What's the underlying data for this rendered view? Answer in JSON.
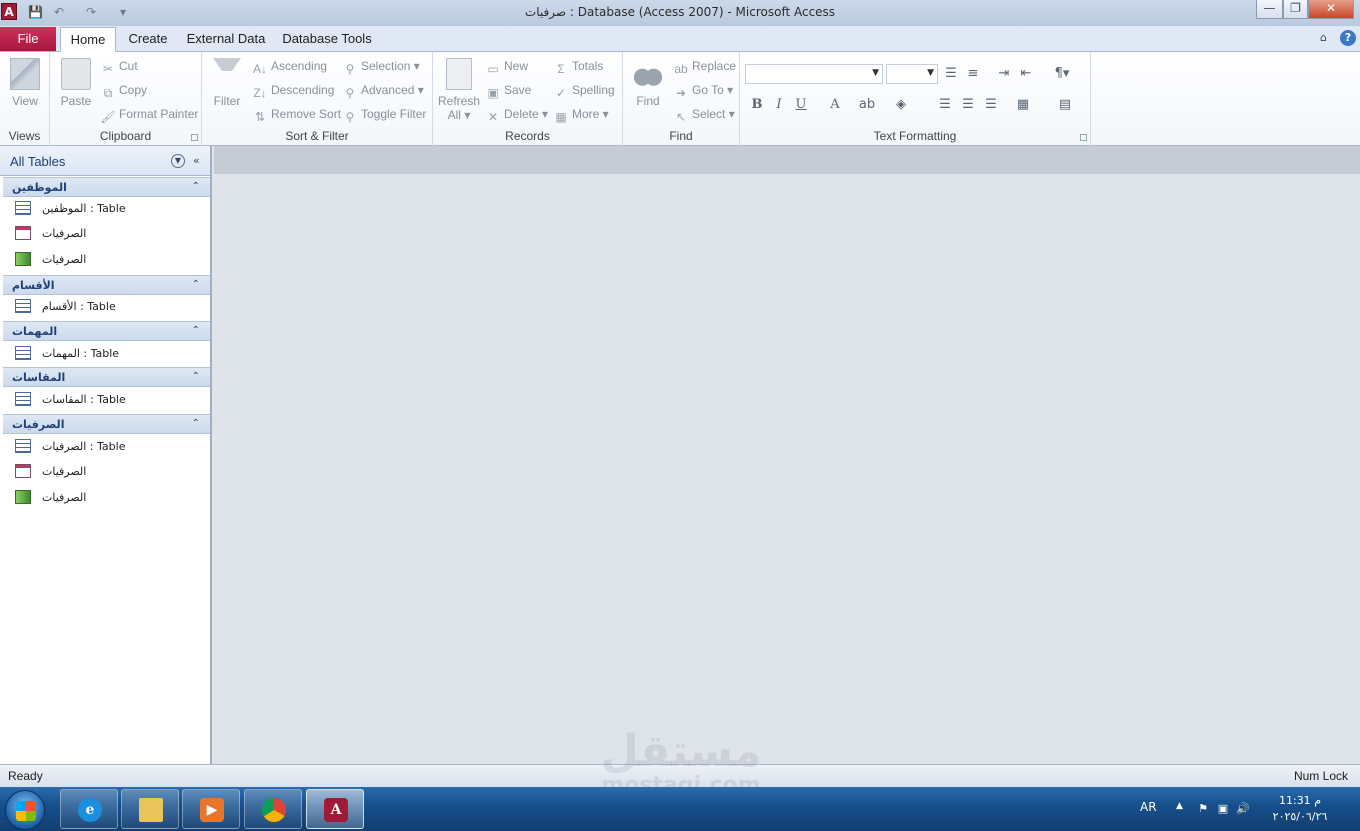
{
  "window": {
    "title": "صرفيات : Database (Access 2007)  -  Microsoft Access",
    "app_icon_glyph": "A",
    "buttons": {
      "minimize": "—",
      "restore": "❐",
      "close": "✕"
    }
  },
  "quick_access": {
    "save_icon": "save-icon",
    "undo_icon": "undo-icon",
    "redo_icon": "redo-icon",
    "customize_icon": "dropdown-icon"
  },
  "ribbon_tabs": {
    "file": "File",
    "tabs": [
      "Home",
      "Create",
      "External Data",
      "Database Tools"
    ],
    "active": "Home"
  },
  "ribbon": {
    "views": {
      "label": "Views",
      "view": "View"
    },
    "clipboard": {
      "label": "Clipboard",
      "paste": "Paste",
      "cut": "Cut",
      "copy": "Copy",
      "format_painter": "Format Painter"
    },
    "sort_filter": {
      "label": "Sort & Filter",
      "filter": "Filter",
      "ascending": "Ascending",
      "descending": "Descending",
      "remove_sort": "Remove Sort",
      "selection": "Selection",
      "advanced": "Advanced",
      "toggle_filter": "Toggle Filter"
    },
    "records": {
      "label": "Records",
      "refresh": "Refresh",
      "refresh_sub": "All",
      "new": "New",
      "save": "Save",
      "delete": "Delete",
      "totals": "Totals",
      "spelling": "Spelling",
      "more": "More"
    },
    "find": {
      "label": "Find",
      "find": "Find",
      "replace": "Replace",
      "go_to": "Go To",
      "select": "Select"
    },
    "text_formatting": {
      "label": "Text Formatting",
      "bold": "B",
      "italic": "I",
      "underline": "U",
      "font_color": "A"
    }
  },
  "nav_pane": {
    "header": "All Tables",
    "groups": [
      {
        "name": "الموظفين",
        "items": [
          {
            "icon": "table",
            "label": "الموظفين : Table"
          },
          {
            "icon": "form",
            "label": "الصرفيات"
          },
          {
            "icon": "report",
            "label": "الصرفيات"
          }
        ]
      },
      {
        "name": "الأقسام",
        "items": [
          {
            "icon": "table",
            "label": "الأقسام : Table"
          }
        ]
      },
      {
        "name": "المهمات",
        "items": [
          {
            "icon": "table",
            "label": "المهمات : Table"
          }
        ]
      },
      {
        "name": "المقاسات",
        "items": [
          {
            "icon": "table",
            "label": "المقاسات : Table"
          }
        ]
      },
      {
        "name": "الصرفيات",
        "items": [
          {
            "icon": "table",
            "label": "الصرفيات : Table"
          },
          {
            "icon": "form",
            "label": "الصرفيات"
          },
          {
            "icon": "report",
            "label": "الصرفيات"
          }
        ]
      }
    ]
  },
  "status_bar": {
    "left": "Ready",
    "right": "Num Lock"
  },
  "taskbar": {
    "apps": [
      "internet-explorer",
      "file-explorer",
      "media-player",
      "chrome",
      "microsoft-access"
    ],
    "active_app": "microsoft-access",
    "tray": {
      "language": "AR",
      "time": "11:31 م",
      "date": "٢٠٢٥/٠٦/٢٦"
    }
  },
  "watermark": {
    "text": "مستقل",
    "sub": "mostaqi.com"
  }
}
